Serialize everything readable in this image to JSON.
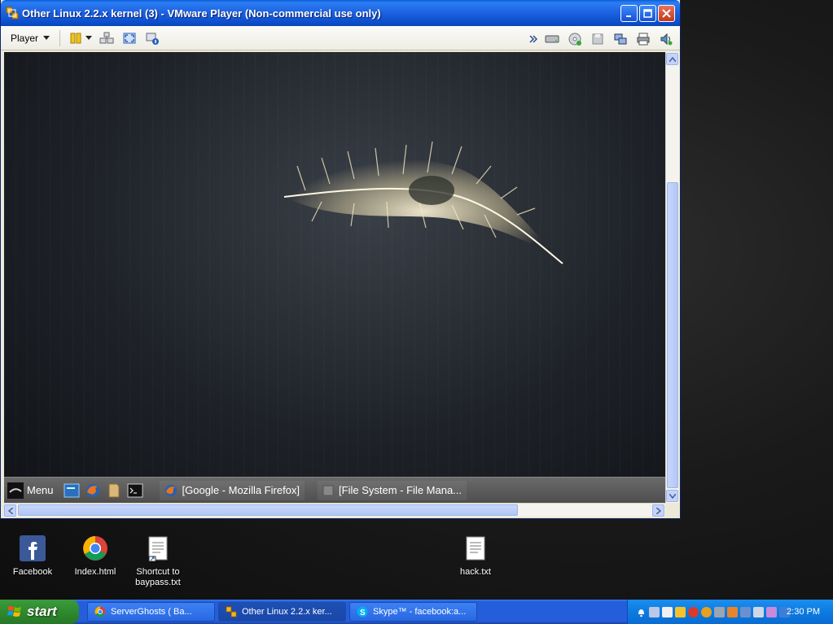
{
  "window": {
    "title": "Other Linux 2.2.x kernel (3) - VMware Player (Non-commercial use only)",
    "player_menu_label": "Player"
  },
  "guest": {
    "panel": {
      "menu_label": "Menu",
      "tasks": [
        {
          "label": "[Google - Mozilla Firefox]"
        },
        {
          "label": "[File System - File Mana..."
        }
      ]
    }
  },
  "desktop_icons": [
    {
      "label": "Facebook",
      "icon": "facebook-icon"
    },
    {
      "label": "Index.html",
      "icon": "chrome-icon"
    },
    {
      "label": "Shortcut to baypass.txt",
      "icon": "text-file-icon"
    },
    {
      "label": "hack.txt",
      "icon": "text-file-icon"
    }
  ],
  "taskbar": {
    "start_label": "start",
    "tasks": [
      {
        "label": "ServerGhosts ( Ba...",
        "icon": "chrome-icon"
      },
      {
        "label": "Other Linux 2.2.x ker...",
        "icon": "vmware-icon"
      },
      {
        "label": "Skype™ - facebook:a...",
        "icon": "skype-icon"
      }
    ],
    "clock": "2:30 PM"
  },
  "colors": {
    "xp_blue": "#245edb",
    "start_green": "#2f8a2f",
    "window_face": "#ece9d8"
  }
}
